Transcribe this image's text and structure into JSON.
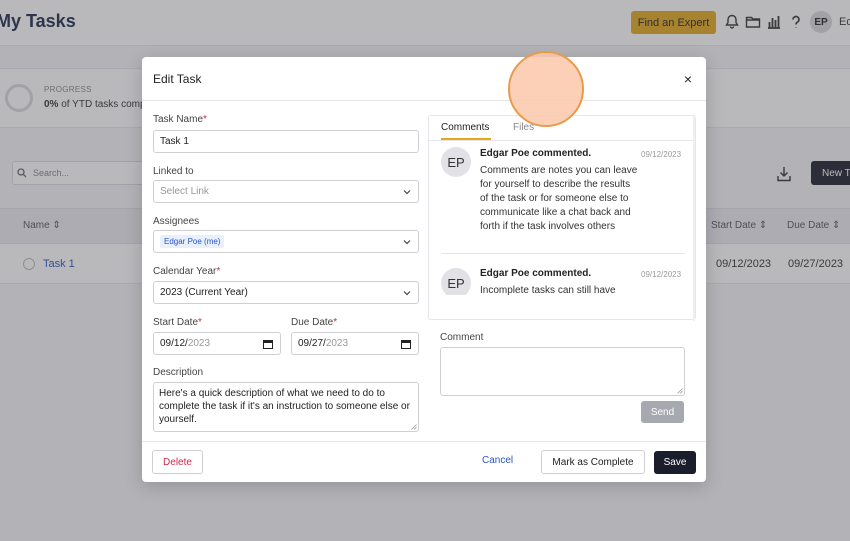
{
  "page": {
    "title": "My Tasks",
    "expert_button": "Find an Expert",
    "user_initials": "EP",
    "user_name_fragment": "Ed",
    "progress_label": "PROGRESS",
    "progress_percent": "0%",
    "progress_text": "of YTD tasks comp",
    "search_placeholder": "Search...",
    "new_button": "New T",
    "columns": [
      "Name",
      "Start Date",
      "Due Date"
    ],
    "rows": [
      {
        "name": "Task 1",
        "start": "09/12/2023",
        "due": "09/27/2023"
      }
    ],
    "colors": {
      "accent": "#e3a81d",
      "primary_dark": "#1a1d2b",
      "link": "#2a55c4",
      "required": "#d0284a"
    }
  },
  "modal": {
    "title": "Edit Task",
    "close": "×",
    "task_name": {
      "label": "Task Name",
      "required": "*",
      "value": "Task 1"
    },
    "linked_to": {
      "label": "Linked to",
      "placeholder": "Select Link"
    },
    "assignees": {
      "label": "Assignees",
      "tag": "Edgar Poe (me)"
    },
    "calendar_year": {
      "label": "Calendar Year",
      "required": "*",
      "value": "2023 (Current Year)"
    },
    "start_date": {
      "label": "Start Date",
      "required": "*",
      "value_main": "09/12/",
      "value_light": "2023"
    },
    "due_date": {
      "label": "Due Date",
      "required": "*",
      "value_main": "09/27/",
      "value_light": "2023"
    },
    "description": {
      "label": "Description",
      "value": "Here's a quick description of what we need to do to complete the task if it's an instruction to someone else or yourself."
    },
    "tabs": {
      "comments": "Comments",
      "files": "Files"
    },
    "comments": [
      {
        "initials": "EP",
        "author": "Edgar Poe commented.",
        "date": "09/12/2023",
        "body": "Comments are notes you can leave for yourself to describe the results of the task or for someone else to communicate like a chat back and forth if the task involves others"
      },
      {
        "initials": "EP",
        "author": "Edgar Poe commented.",
        "date": "09/12/2023",
        "body": "Incomplete tasks can still have"
      }
    ],
    "comment_label": "Comment",
    "send": "Send",
    "delete": "Delete",
    "cancel": "Cancel",
    "mark_complete": "Mark as Complete",
    "save": "Save"
  }
}
